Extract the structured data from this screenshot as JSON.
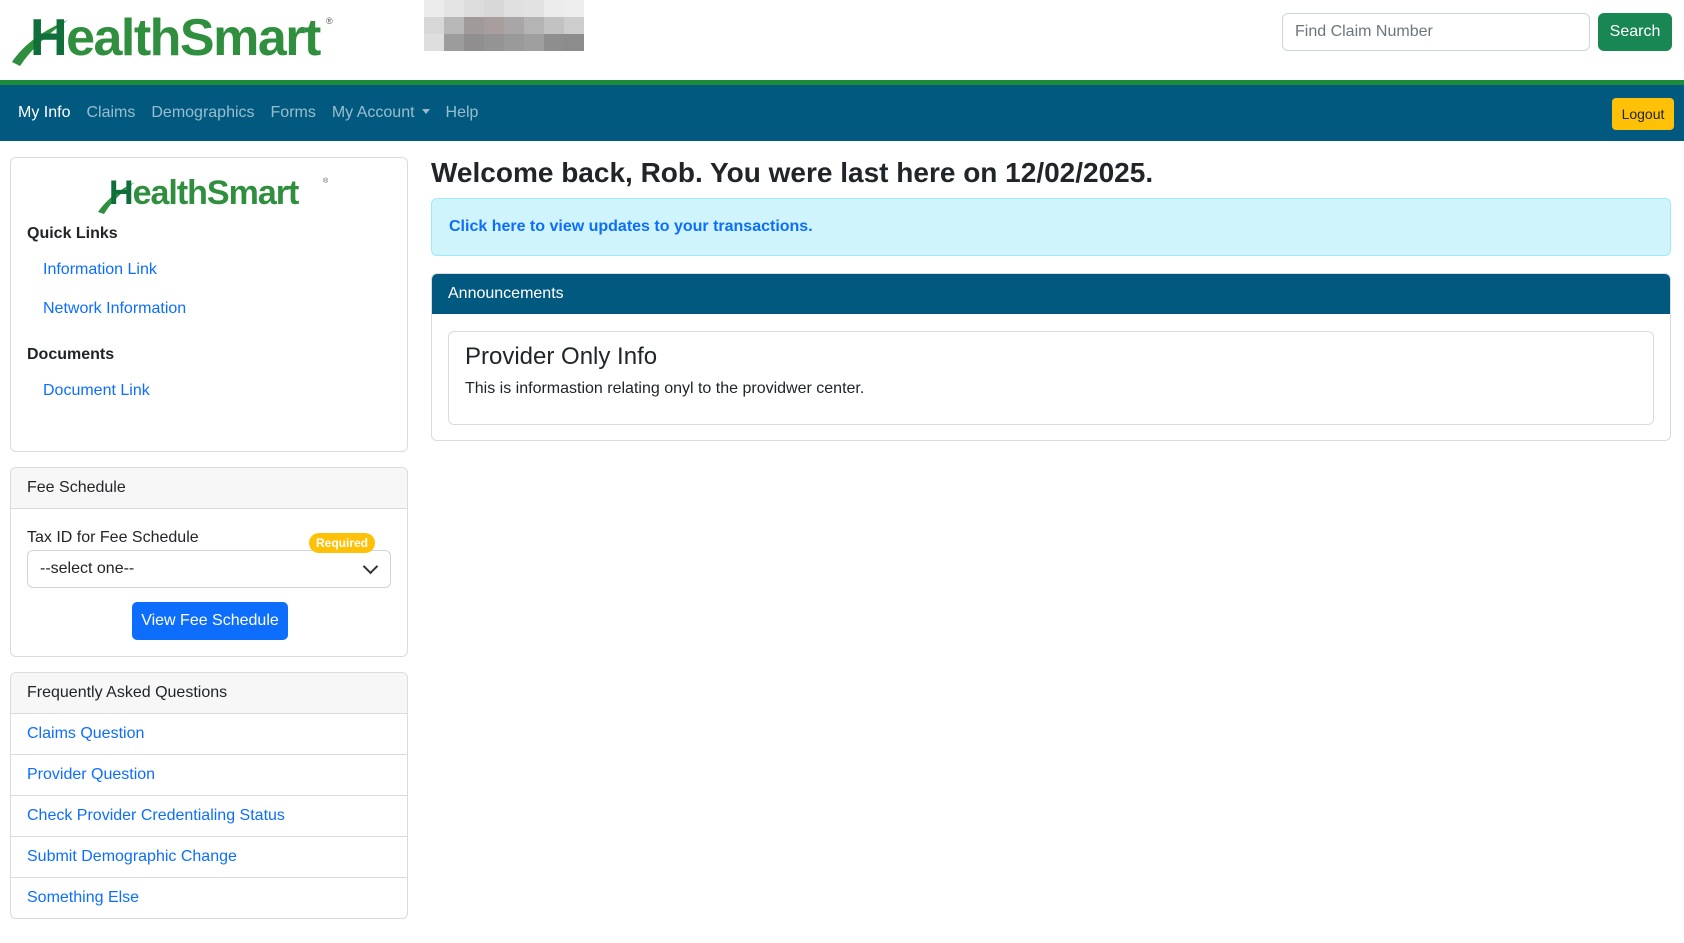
{
  "brand": {
    "name_first": "H",
    "name_rest": "ealthSmart",
    "registered": "®"
  },
  "header": {
    "search_placeholder": "Find Claim Number",
    "search_button": "Search"
  },
  "nav": {
    "items": [
      {
        "label": "My Info",
        "active": true
      },
      {
        "label": "Claims"
      },
      {
        "label": "Demographics"
      },
      {
        "label": "Forms"
      },
      {
        "label": "My Account",
        "dropdown": true
      },
      {
        "label": "Help"
      }
    ],
    "logout": "Logout"
  },
  "sidebar": {
    "quick_links_title": "Quick Links",
    "quick_links": [
      "Information Link",
      "Network Information"
    ],
    "documents_title": "Documents",
    "documents": [
      "Document Link"
    ],
    "fee_schedule": {
      "title": "Fee Schedule",
      "label": "Tax ID for Fee Schedule",
      "required_badge": "Required",
      "select_value": "--select one--",
      "button": "View Fee Schedule"
    },
    "faq": {
      "title": "Frequently Asked Questions",
      "items": [
        "Claims Question",
        "Provider Question",
        "Check Provider Credentialing Status",
        "Submit Demographic Change",
        "Something Else"
      ]
    }
  },
  "main": {
    "welcome": "Welcome back, Rob. You were last here on 12/02/2025.",
    "alert_link": "Click here to view updates to your transactions.",
    "announcements": {
      "title": "Announcements",
      "item_title": "Provider Only Info",
      "item_text": "This is informastion relating onyl to the providwer center."
    }
  },
  "colors": {
    "navbar": "#015980",
    "brand_green": "#2f8f3e",
    "search_button": "#198754",
    "logout_button": "#ffc107",
    "primary": "#0d6efd",
    "alert_bg": "#cff4fc"
  }
}
